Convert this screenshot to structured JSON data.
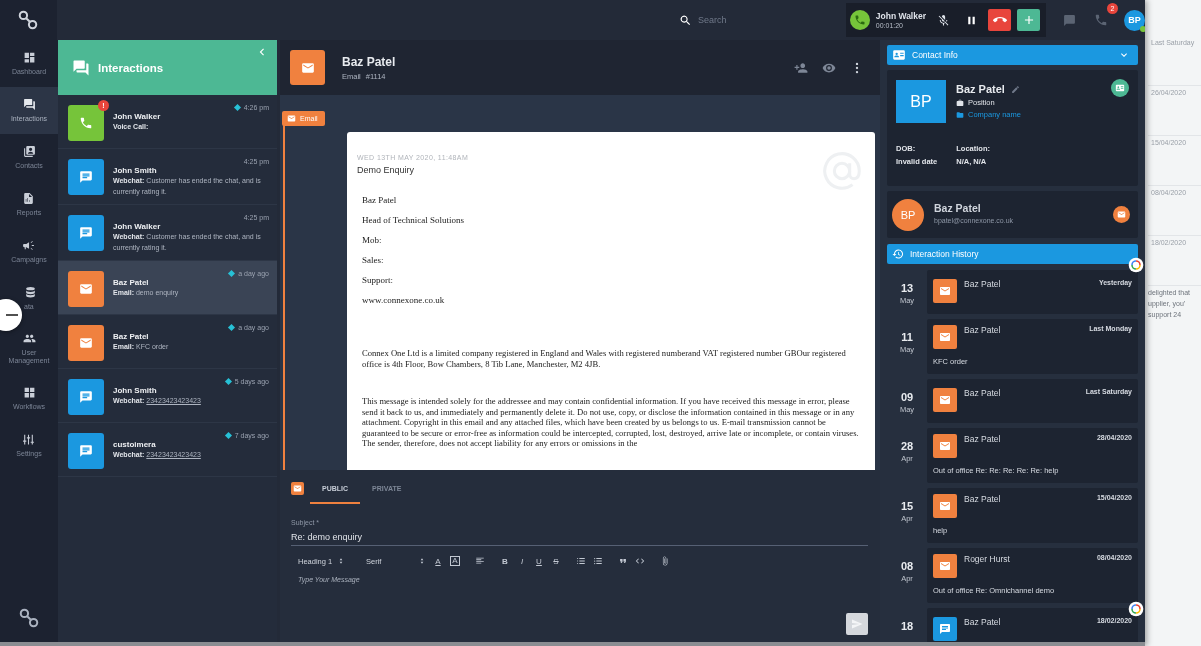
{
  "top_bar": {
    "search": {
      "placeholder": "Search"
    },
    "call": {
      "name": "John Walker",
      "timer": "00:01:20"
    },
    "notification_count": "2",
    "avatar": "BP",
    "online": true
  },
  "nav": [
    {
      "label": "Dashboard",
      "selected": false
    },
    {
      "label": "Interactions",
      "selected": true
    },
    {
      "label": "Contacts",
      "selected": false
    },
    {
      "label": "Reports",
      "selected": false
    },
    {
      "label": "Campaigns",
      "selected": false
    },
    {
      "label": "ata",
      "selected": false
    },
    {
      "label": "User Management",
      "selected": false
    },
    {
      "label": "Workflows",
      "selected": false
    },
    {
      "label": "Settings",
      "selected": false
    }
  ],
  "interactions": {
    "title": "Interactions",
    "items": [
      {
        "kind": "voice",
        "name": "John Walker",
        "channel_label": "Voice Call:",
        "time": "4:26 pm",
        "unread": true,
        "alert": "!",
        "selected": false
      },
      {
        "kind": "webchat",
        "name": "John Smith",
        "channel_label": "Webchat:",
        "detail": "Customer has ended the chat, and is currently rating it.",
        "time": "4:25 pm",
        "unread": false,
        "selected": false
      },
      {
        "kind": "webchat",
        "name": "John Walker",
        "channel_label": "Webchat:",
        "detail": "Customer has ended the chat, and is currently rating it.",
        "time": "4:25 pm",
        "unread": false,
        "selected": false
      },
      {
        "kind": "email",
        "name": "Baz Patel",
        "channel_label": "Email:",
        "detail": "demo enquiry",
        "time": "a day ago",
        "unread": true,
        "selected": true
      },
      {
        "kind": "email",
        "name": "Baz Patel",
        "channel_label": "Email:",
        "detail": "KFC order",
        "time": "a day ago",
        "unread": true,
        "selected": false
      },
      {
        "kind": "webchat",
        "name": "John Smith",
        "channel_label": "Webchat:",
        "link": "23423423423423",
        "time": "5 days ago",
        "unread": true,
        "selected": false
      },
      {
        "kind": "webchat",
        "name": "custoimera",
        "channel_label": "Webchat:",
        "link": "23423423423423",
        "time": "7 days ago",
        "unread": true,
        "selected": false
      }
    ]
  },
  "conversation": {
    "name": "Baz Patel",
    "channel": "Email",
    "ticket": "#1114",
    "tag": "Email",
    "email": {
      "date": "WED 13TH MAY 2020, 11:48AM",
      "subject": "Demo Enquiry",
      "lines": [
        "Baz Patel",
        "Head of Technical Solutions",
        "Mob:",
        "Sales:",
        "Support:",
        "www.connexone.co.uk"
      ],
      "paragraphs": [
        "Connex One Ltd is a limited company registered in England and Wales with registered numberand VAT registered number GBOur registered office is 4th Floor, Bow Chambers, 8 Tib Lane, Manchester, M2 4JB.",
        "This message is intended solely for the addressee and may contain confidential information. If you have received this message in error, please send it back to us, and immediately and permanently delete it. Do not use, copy, or disclose the information contained in this message or in any attachment. Copyright in this email and any attached files, which have been created by us belongs to us. E-mail transmission cannot be guaranteed to be secure or error-free as information could be intercepted, corrupted, lost, destroyed, arrive late or incomplete, or contain viruses. The sender, therefore, does not accept liability for any errors or omissions in the"
      ]
    },
    "composer": {
      "tabs": [
        {
          "label": "PUBLIC",
          "selected": true
        },
        {
          "label": "PRIVATE",
          "selected": false
        }
      ],
      "subject_label": "Subject *",
      "subject": "Re: demo enquiry",
      "block_format": "Heading 1",
      "font": "Serif",
      "tools": [
        {
          "kind": "text-color",
          "label": "A"
        },
        {
          "kind": "background",
          "label": "A"
        },
        {
          "kind": "align"
        },
        {
          "kind": "bold",
          "label": "B"
        },
        {
          "kind": "italic",
          "label": "I"
        },
        {
          "kind": "underline",
          "label": "U"
        },
        {
          "kind": "strike",
          "label": "S"
        },
        {
          "kind": "ordered-list"
        },
        {
          "kind": "bullet-list"
        },
        {
          "kind": "quote"
        },
        {
          "kind": "code"
        },
        {
          "kind": "attach"
        }
      ],
      "placeholder": "Type Your Message",
      "send_disabled": true
    }
  },
  "contact": {
    "header": "Contact Info",
    "initials": "BP",
    "name": "Baz Patel",
    "position": "Position",
    "company": "Company name",
    "dob_label": "DOB:",
    "dob": "Invalid date",
    "location_label": "Location:",
    "location": "N/A, N/A",
    "email_card": {
      "initials": "BP",
      "name": "Baz Patel",
      "email": "bpatel@connexone.co.uk"
    },
    "history_header": "Interaction History",
    "history": [
      {
        "day": "13",
        "month": "May",
        "kind": "email",
        "name": "Baz Patel",
        "when": "Yesterday"
      },
      {
        "day": "11",
        "month": "May",
        "kind": "email",
        "name": "Baz Patel",
        "when": "Last Monday",
        "subject": "KFC order"
      },
      {
        "day": "09",
        "month": "May",
        "kind": "email",
        "name": "Baz Patel",
        "when": "Last Saturday"
      },
      {
        "day": "28",
        "month": "Apr",
        "kind": "email",
        "name": "Baz Patel",
        "when": "28/04/2020",
        "subject": "Out of office Re: Re: Re: Re: Re: help"
      },
      {
        "day": "15",
        "month": "Apr",
        "kind": "email",
        "name": "Baz Patel",
        "when": "15/04/2020",
        "subject": "help"
      },
      {
        "day": "08",
        "month": "Apr",
        "kind": "email",
        "name": "Roger Hurst",
        "when": "08/04/2020",
        "subject": "Out of office Re: Omnichannel demo"
      },
      {
        "day": "18",
        "kind": "webchat",
        "name": "Baz Patel",
        "when": "18/02/2020"
      }
    ]
  },
  "background_page": {
    "texts": [
      "Last Saturday",
      "26/04/2020",
      "15/04/2020",
      "08/04/2020",
      "18/02/2020"
    ],
    "snippet": [
      "delighted that",
      "upplier, you'",
      "support 24"
    ]
  }
}
